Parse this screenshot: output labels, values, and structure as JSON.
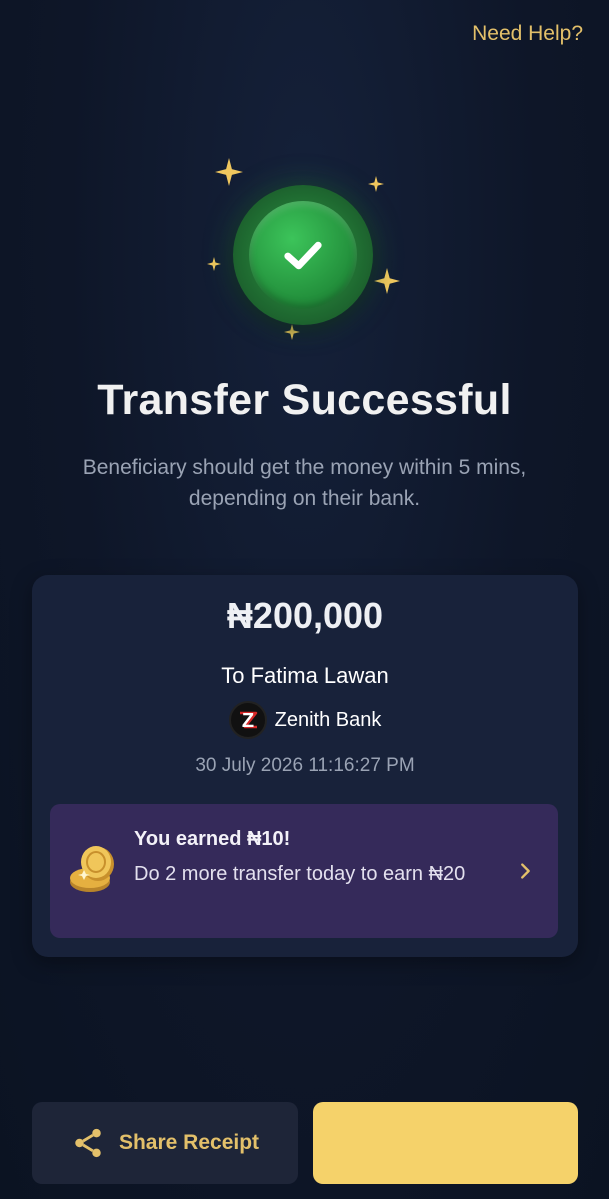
{
  "header": {
    "help_link": "Need Help?"
  },
  "status": {
    "title": "Transfer Successful",
    "subtitle": "Beneficiary should get the money within 5 mins, depending on their bank."
  },
  "receipt": {
    "amount": "₦200,000",
    "recipient": "To Fatima Lawan",
    "bank_logo_letter": "Z",
    "bank_name": "Zenith Bank",
    "timestamp": "30 July 2026 11:16:27 PM"
  },
  "promo": {
    "title": "You earned ₦10!",
    "text": "Do 2 more transfer today to earn ₦20"
  },
  "actions": {
    "share_label": "Share Receipt",
    "primary_label": ""
  },
  "colors": {
    "accent": "#e3c06a",
    "success": "#2ea043",
    "primary_button": "#f5d26a",
    "promo_bg": "#352a5a",
    "card_bg": "#18223a"
  },
  "icons": {
    "success": "check-icon",
    "reward": "coin-icon",
    "promo_arrow": "chevron-right-icon",
    "share": "share-icon",
    "decor": "sparkle-icon"
  }
}
